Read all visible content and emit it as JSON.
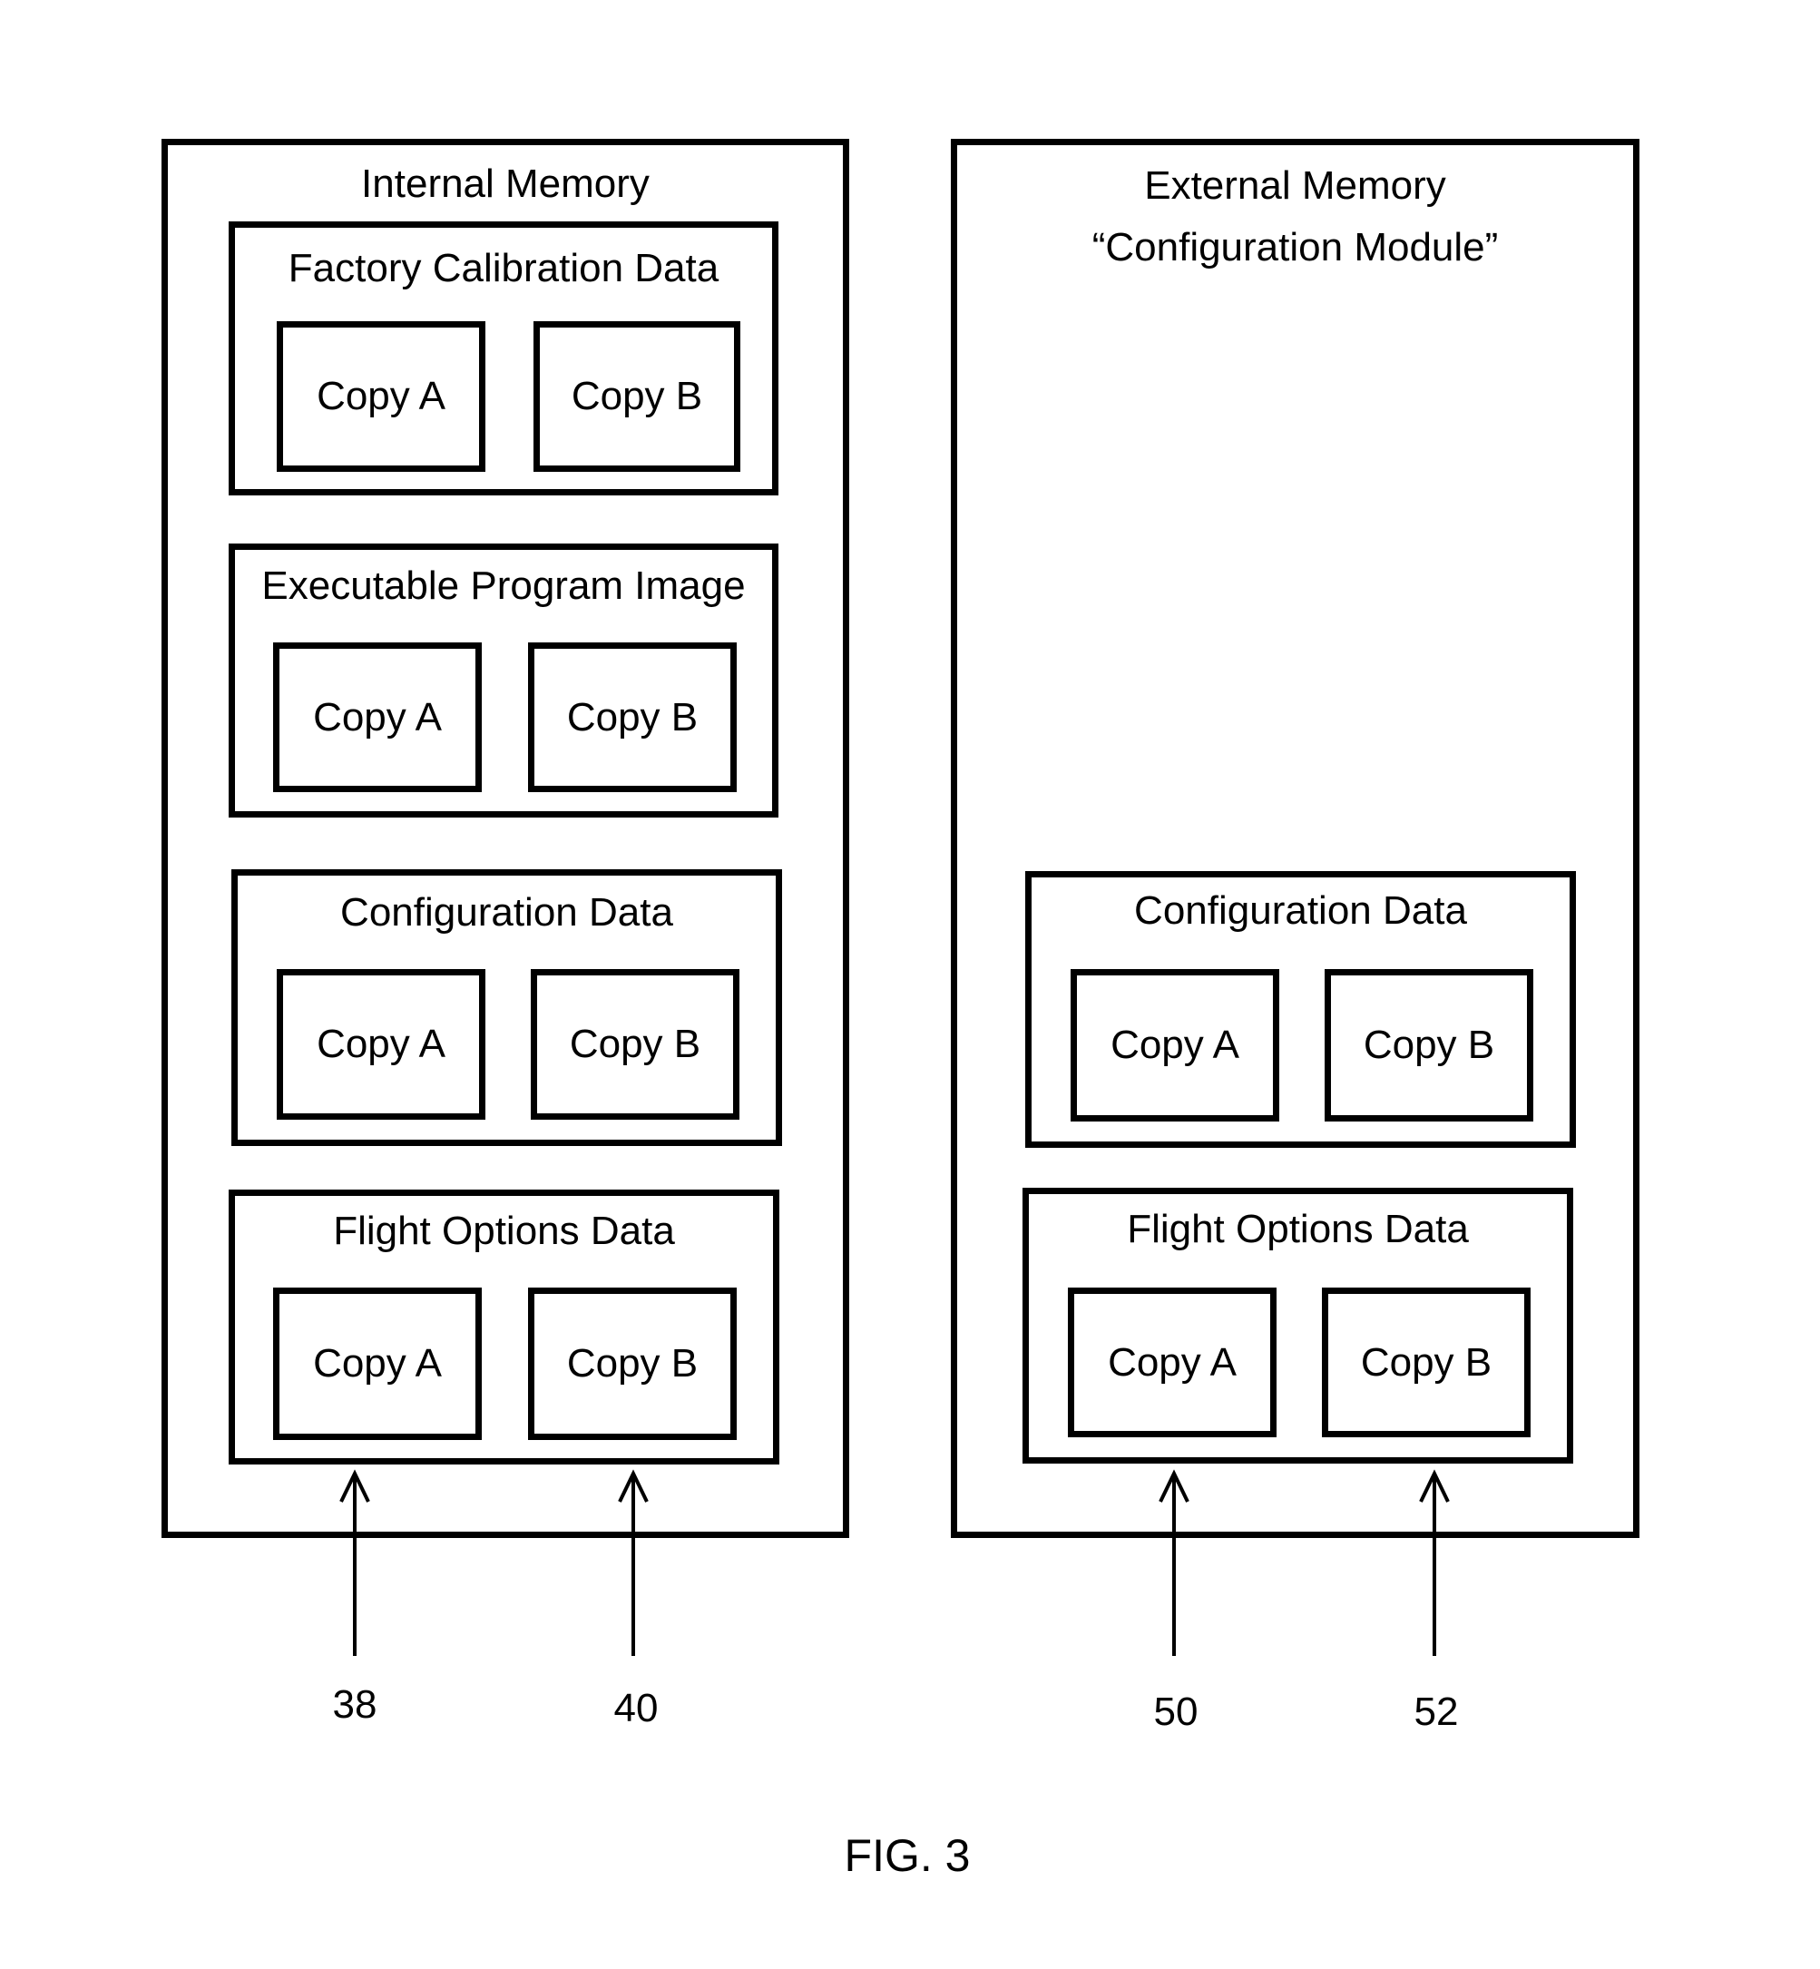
{
  "figure_label": "FIG. 3",
  "internal": {
    "title": "Internal Memory",
    "groups": [
      {
        "title": "Factory Calibration Data",
        "copy_a": "Copy A",
        "copy_b": "Copy B"
      },
      {
        "title": "Executable Program Image",
        "copy_a": "Copy A",
        "copy_b": "Copy B"
      },
      {
        "title": "Configuration Data",
        "copy_a": "Copy A",
        "copy_b": "Copy B"
      },
      {
        "title": "Flight Options Data",
        "copy_a": "Copy A",
        "copy_b": "Copy B"
      }
    ]
  },
  "external": {
    "title": "External Memory",
    "subtitle": "“Configuration Module”",
    "groups": [
      {
        "title": "Configuration Data",
        "copy_a": "Copy A",
        "copy_b": "Copy B"
      },
      {
        "title": "Flight Options Data",
        "copy_a": "Copy A",
        "copy_b": "Copy B"
      }
    ]
  },
  "references": [
    "38",
    "40",
    "50",
    "52"
  ]
}
